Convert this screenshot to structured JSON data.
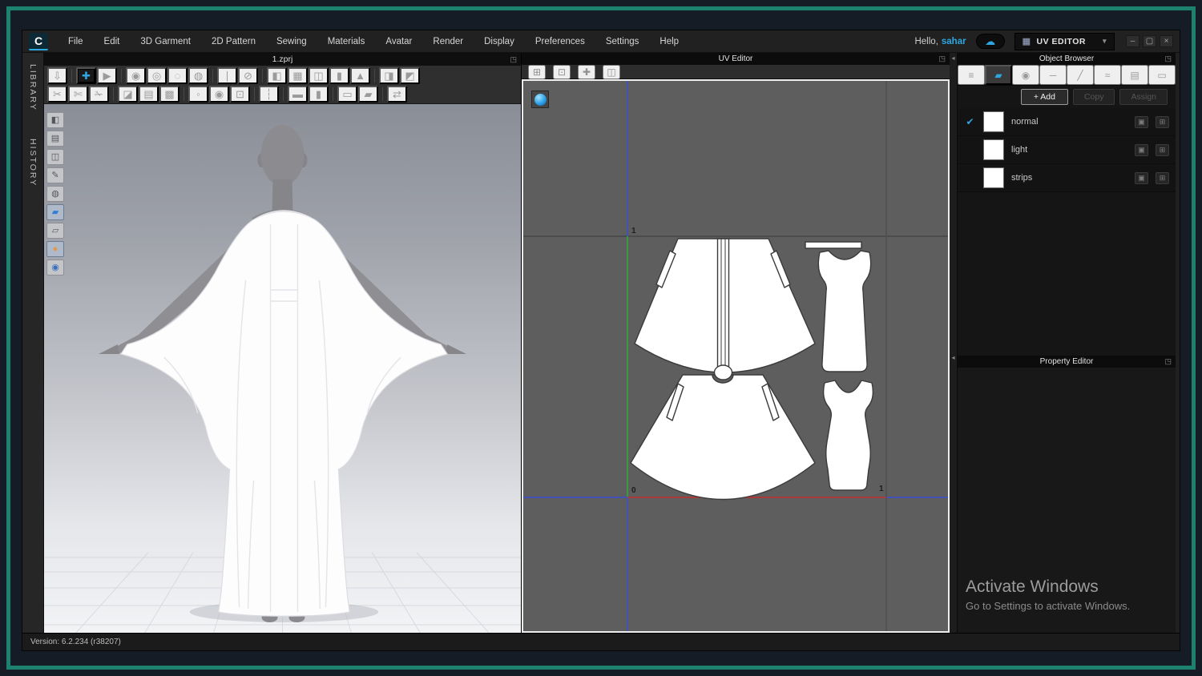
{
  "colors": {
    "accent": "#2ea7e0",
    "frame_teal": "#1d8170",
    "swatch": "#ffffff"
  },
  "menu": {
    "logo": "C",
    "items": [
      {
        "name": "menu-file",
        "label": "File"
      },
      {
        "name": "menu-edit",
        "label": "Edit"
      },
      {
        "name": "menu-3d-garment",
        "label": "3D Garment"
      },
      {
        "name": "menu-2d-pattern",
        "label": "2D Pattern"
      },
      {
        "name": "menu-sewing",
        "label": "Sewing"
      },
      {
        "name": "menu-materials",
        "label": "Materials"
      },
      {
        "name": "menu-avatar",
        "label": "Avatar"
      },
      {
        "name": "menu-render",
        "label": "Render"
      },
      {
        "name": "menu-display",
        "label": "Display"
      },
      {
        "name": "menu-preferences",
        "label": "Preferences"
      },
      {
        "name": "menu-settings",
        "label": "Settings"
      },
      {
        "name": "menu-help",
        "label": "Help"
      }
    ]
  },
  "account": {
    "greeting": "Hello,",
    "user": "sahar",
    "cloud_icon": "☁"
  },
  "mode_selector": {
    "icon": "▦",
    "label": "UV EDITOR",
    "caret": "▾"
  },
  "window_controls": [
    {
      "name": "minimize-button",
      "glyph": "–"
    },
    {
      "name": "restore-button",
      "glyph": "▢"
    },
    {
      "name": "close-button",
      "glyph": "×"
    }
  ],
  "side_tabs": [
    {
      "name": "tab-library",
      "label": "LIBRARY"
    },
    {
      "name": "tab-history",
      "label": "HISTORY"
    }
  ],
  "document": {
    "tab": "1.zprj",
    "popout": "◳"
  },
  "toolbar": {
    "row1": [
      {
        "name": "down-arrow-icon",
        "glyph": "⇩"
      },
      {
        "sep": true
      },
      {
        "name": "select-move-icon",
        "glyph": "✚",
        "active": true
      },
      {
        "name": "select-mesh-icon",
        "glyph": "▶"
      },
      {
        "sep": true
      },
      {
        "name": "tack-garment-icon",
        "glyph": "◉"
      },
      {
        "name": "pin-box-icon",
        "glyph": "◎"
      },
      {
        "name": "pin-curve-icon",
        "glyph": "◌"
      },
      {
        "name": "tack-avatar-icon",
        "glyph": "◍"
      },
      {
        "sep": true
      },
      {
        "name": "needle-icon",
        "glyph": "∣"
      },
      {
        "name": "eraser-icon",
        "glyph": "⊘"
      },
      {
        "sep": true
      },
      {
        "name": "fold-arrangement-icon",
        "glyph": "◧"
      },
      {
        "name": "fit-garment-icon",
        "glyph": "▦"
      },
      {
        "name": "open-garment-icon",
        "glyph": "◫"
      },
      {
        "name": "vest-icon",
        "glyph": "▮"
      },
      {
        "name": "avatar-garment-icon",
        "glyph": "▲"
      },
      {
        "sep": true
      },
      {
        "name": "stripe-garment-left-icon",
        "glyph": "◨"
      },
      {
        "name": "stripe-garment-right-icon",
        "glyph": "◩"
      }
    ],
    "row2": [
      {
        "name": "cut-sew-icon",
        "glyph": "✂"
      },
      {
        "name": "cut-pen-icon",
        "glyph": "✄"
      },
      {
        "name": "cut-knife-icon",
        "glyph": "✁"
      },
      {
        "sep": true
      },
      {
        "name": "texture-cursor-icon",
        "glyph": "◪"
      },
      {
        "name": "texture-garment-icon",
        "glyph": "▤"
      },
      {
        "name": "checker-garment-icon",
        "glyph": "▩"
      },
      {
        "sep": true
      },
      {
        "name": "button-cursor-icon",
        "glyph": "◦"
      },
      {
        "name": "button-icon",
        "glyph": "◉"
      },
      {
        "name": "buttonhole-icon",
        "glyph": "⊡"
      },
      {
        "sep": true
      },
      {
        "name": "zipper-icon",
        "glyph": "┆"
      },
      {
        "sep": true
      },
      {
        "name": "fabric-cursor-icon",
        "glyph": "▬"
      },
      {
        "name": "fabric-roll-icon",
        "glyph": "▮"
      },
      {
        "sep": true
      },
      {
        "name": "trim-cursor-icon",
        "glyph": "▭"
      },
      {
        "name": "trim-roll-icon",
        "glyph": "▰"
      },
      {
        "sep": true
      },
      {
        "name": "pleat-icon",
        "glyph": "⇄"
      }
    ]
  },
  "viewport_tools": [
    {
      "name": "show-3d-render-icon",
      "glyph": "◧"
    },
    {
      "name": "show-garment-fit-icon",
      "glyph": "▤"
    },
    {
      "name": "show-garment-icon",
      "glyph": "◫"
    },
    {
      "name": "show-sewing-icon",
      "glyph": "✎"
    },
    {
      "name": "show-avatar-icon",
      "glyph": "◍"
    },
    {
      "name": "fabric-view-icon",
      "glyph": "▰",
      "cls": "blue",
      "active": true
    },
    {
      "name": "fabric-mesh-icon",
      "glyph": "▱"
    },
    {
      "name": "avatar-skin-icon",
      "glyph": "●",
      "cls": "orange",
      "active": true
    },
    {
      "name": "world-map-icon",
      "glyph": "◉",
      "cls": "globe"
    }
  ],
  "uv_editor": {
    "title": "UV Editor",
    "popout": "◳",
    "tools": [
      {
        "name": "capture-uv-icon",
        "glyph": "⊞"
      },
      {
        "name": "capture-pattern-icon",
        "glyph": "⊡"
      },
      {
        "name": "move-pattern-icon",
        "glyph": "✚"
      },
      {
        "name": "arrange-pattern-icon",
        "glyph": "◫"
      }
    ],
    "labels": {
      "v1": "1",
      "origin": "0",
      "u1": "1"
    }
  },
  "object_browser": {
    "title": "Object Browser",
    "popout": "◳",
    "dock_arrow": "◂",
    "tabs": [
      {
        "name": "tab-object-list",
        "glyph": "≡"
      },
      {
        "name": "tab-fabric",
        "glyph": "▰",
        "active": true
      },
      {
        "name": "tab-button",
        "glyph": "◉"
      },
      {
        "name": "tab-topstitch",
        "glyph": "─"
      },
      {
        "name": "tab-stitch",
        "glyph": "╱"
      },
      {
        "name": "tab-puckering",
        "glyph": "≈"
      },
      {
        "name": "tab-piping",
        "glyph": "▤"
      },
      {
        "name": "tab-trim",
        "glyph": "▭"
      }
    ],
    "actions": {
      "add": "+ Add",
      "copy": "Copy",
      "assign": "Assign"
    },
    "check": "✔",
    "row_tools": [
      {
        "name": "duplicate-icon",
        "glyph": "▣"
      },
      {
        "name": "add-to-icon",
        "glyph": "⊞"
      }
    ],
    "items": [
      {
        "id": "object-row-normal",
        "label": "normal",
        "checked": true
      },
      {
        "id": "object-row-light",
        "label": "light",
        "checked": false
      },
      {
        "id": "object-row-strips",
        "label": "strips",
        "checked": false
      }
    ]
  },
  "property_editor": {
    "title": "Property Editor",
    "popout": "◳",
    "dock_arrow": "◂"
  },
  "watermark": {
    "title": "Activate Windows",
    "subtitle": "Go to Settings to activate Windows."
  },
  "status": {
    "version": "Version: 6.2.234 (r38207)"
  }
}
